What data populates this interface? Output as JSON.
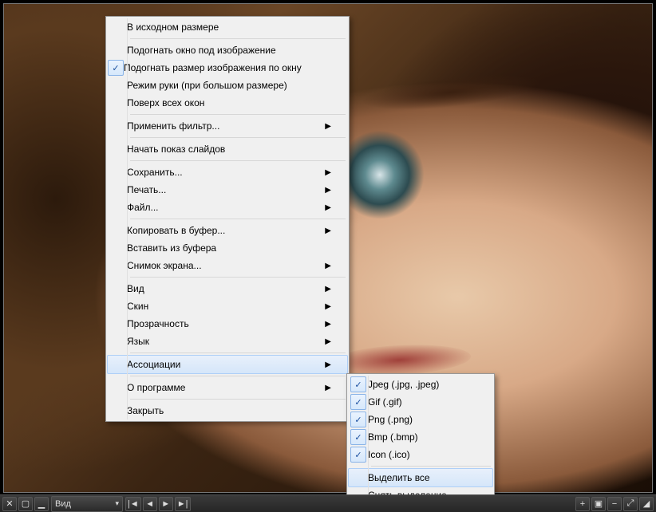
{
  "context_menu": {
    "items": [
      {
        "label": "В исходном размере",
        "checked": false,
        "submenu": false
      },
      {
        "sep": true
      },
      {
        "label": "Подогнать окно под изображение",
        "checked": false,
        "submenu": false
      },
      {
        "label": "Подогнать размер изображения по окну",
        "checked": true,
        "submenu": false
      },
      {
        "label": "Режим руки (при большом размере)",
        "checked": false,
        "submenu": false
      },
      {
        "label": "Поверх всех окон",
        "checked": false,
        "submenu": false
      },
      {
        "sep": true
      },
      {
        "label": "Применить фильтр...",
        "checked": false,
        "submenu": true
      },
      {
        "sep": true
      },
      {
        "label": "Начать показ слайдов",
        "checked": false,
        "submenu": false
      },
      {
        "sep": true
      },
      {
        "label": "Сохранить...",
        "checked": false,
        "submenu": true
      },
      {
        "label": "Печать...",
        "checked": false,
        "submenu": true
      },
      {
        "label": "Файл...",
        "checked": false,
        "submenu": true
      },
      {
        "sep": true
      },
      {
        "label": "Копировать в буфер...",
        "checked": false,
        "submenu": true
      },
      {
        "label": "Вставить из буфера",
        "checked": false,
        "submenu": false
      },
      {
        "label": "Снимок экрана...",
        "checked": false,
        "submenu": true
      },
      {
        "sep": true
      },
      {
        "label": "Вид",
        "checked": false,
        "submenu": true
      },
      {
        "label": "Скин",
        "checked": false,
        "submenu": true
      },
      {
        "label": "Прозрачность",
        "checked": false,
        "submenu": true
      },
      {
        "label": "Язык",
        "checked": false,
        "submenu": true
      },
      {
        "sep": true
      },
      {
        "label": "Ассоциации",
        "checked": false,
        "submenu": true,
        "highlight": true
      },
      {
        "sep": true
      },
      {
        "label": "О программе",
        "checked": false,
        "submenu": true
      },
      {
        "sep": true
      },
      {
        "label": "Закрыть",
        "checked": false,
        "submenu": false
      }
    ]
  },
  "submenu": {
    "items": [
      {
        "label": "Jpeg (.jpg, .jpeg)",
        "checked": true
      },
      {
        "label": "Gif (.gif)",
        "checked": true
      },
      {
        "label": "Png (.png)",
        "checked": true
      },
      {
        "label": "Bmp (.bmp)",
        "checked": true
      },
      {
        "label": "Icon (.ico)",
        "checked": true
      },
      {
        "sep": true
      },
      {
        "label": "Выделить все",
        "checked": false,
        "highlight": true
      },
      {
        "label": "Снять выделение",
        "checked": false
      }
    ]
  },
  "toolbar": {
    "view_label": "Вид"
  }
}
